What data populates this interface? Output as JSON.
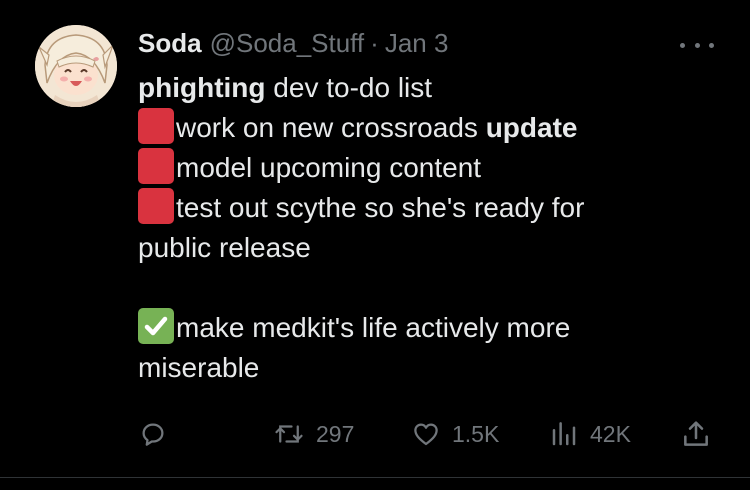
{
  "tweet": {
    "display_name": "Soda",
    "handle": "@Soda_Stuff",
    "separator": "·",
    "date": "Jan 3",
    "lines": {
      "l1_bold": "phighting",
      "l1_rest": " dev to-do list",
      "l2_text": "work on new crossroads ",
      "l2_bold": "update",
      "l3_text": "model upcoming content",
      "l4_text": "test out scythe so she's ready for",
      "l5_text": "public release",
      "l6_text": "make medkit's life actively more",
      "l7_text": "miserable"
    },
    "emoji": {
      "todo": "red-square-emoji",
      "done": "check-mark-button-emoji"
    }
  },
  "actions": {
    "reply_count": "",
    "retweet_count": "297",
    "like_count": "1.5K",
    "views_count": "42K"
  },
  "colors": {
    "background": "#000000",
    "text": "#e7e9ea",
    "muted": "#71767b",
    "red_square": "#d9333f",
    "check_green": "#77b255",
    "divider": "#2f3336"
  }
}
